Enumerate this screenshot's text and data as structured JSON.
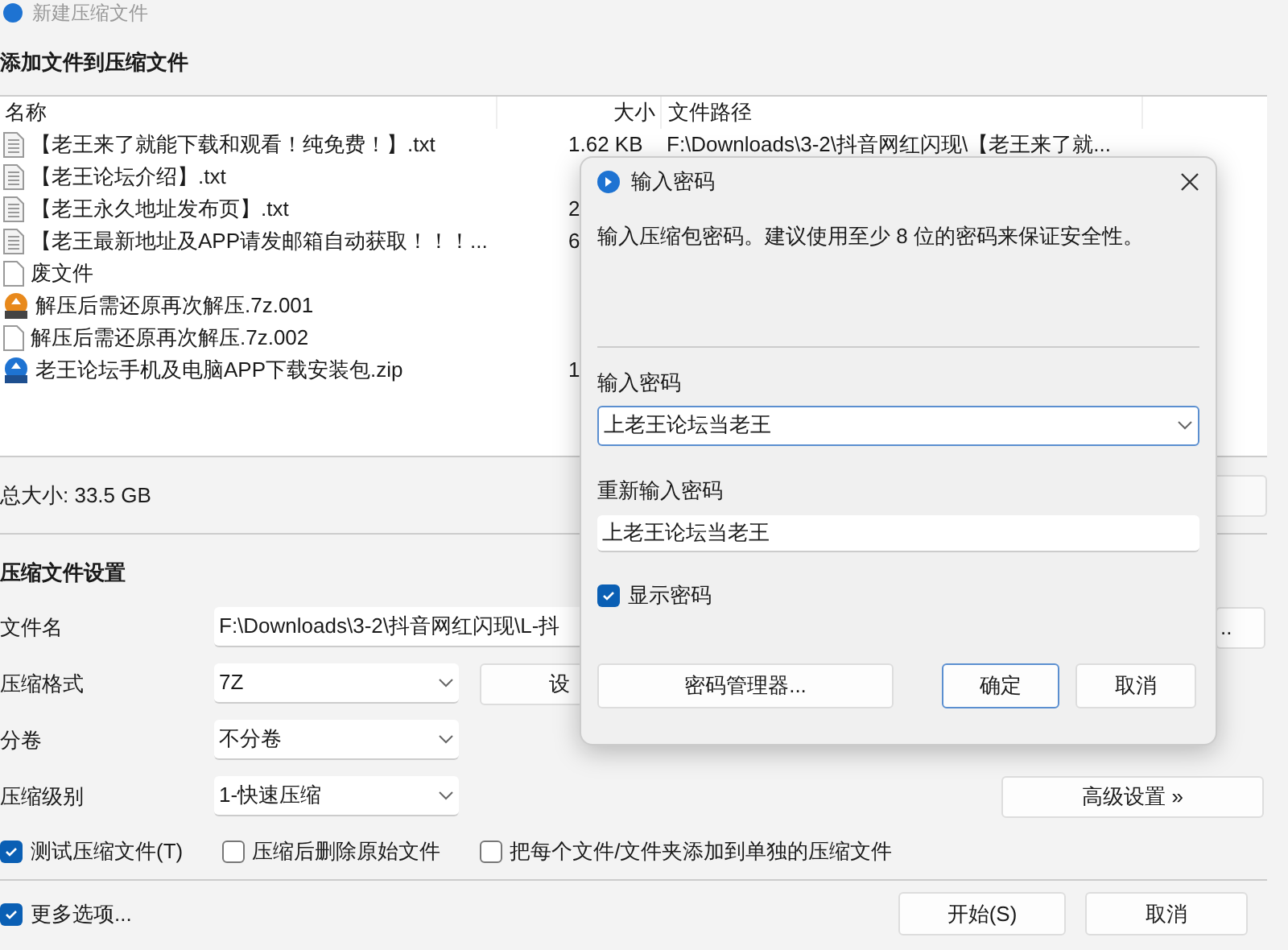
{
  "window": {
    "title": "新建压缩文件"
  },
  "heading": "添加文件到压缩文件",
  "file_list": {
    "columns": [
      "名称",
      "大小",
      "文件路径"
    ],
    "rows": [
      {
        "kind": "text",
        "name": "【老王来了就能下载和观看！纯免费！】.txt",
        "size": "1.62 KB",
        "path": "F:\\Downloads\\3-2\\抖音网红闪现\\【老王来了就..."
      },
      {
        "kind": "text",
        "name": "【老王论坛介绍】.txt"
      },
      {
        "kind": "text",
        "name": "【老王永久地址发布页】.txt",
        "size": "2"
      },
      {
        "kind": "text",
        "name": "【老王最新地址及APP请发邮箱自动获取！！！...",
        "size": "6"
      },
      {
        "kind": "blank",
        "name": "废文件"
      },
      {
        "kind": "archive-7z",
        "name": "解压后需还原再次解压.7z.001"
      },
      {
        "kind": "blank",
        "name": "解压后需还原再次解压.7z.002"
      },
      {
        "kind": "archive-zip",
        "name": "老王论坛手机及电脑APP下载安装包.zip",
        "size": "1"
      }
    ]
  },
  "total_size": "总大小: 33.5 GB",
  "settings": {
    "title": "压缩文件设置",
    "file_name": {
      "label": "文件名",
      "value": "F:\\Downloads\\3-2\\抖音网红闪现\\L-抖",
      "browse": ".."
    },
    "format": {
      "label": "压缩格式",
      "value": "7Z",
      "button": "设"
    },
    "volume": {
      "label": "分卷",
      "value": "不分卷"
    },
    "level": {
      "label": "压缩级别",
      "value": "1-快速压缩",
      "button": "高级设置 »"
    },
    "options": [
      {
        "label": "测试压缩文件(T)",
        "checked": true
      },
      {
        "label": "压缩后删除原始文件",
        "checked": false
      },
      {
        "label": "把每个文件/文件夹添加到单独的压缩文件",
        "checked": false
      }
    ]
  },
  "more_options": {
    "label": "更多选项...",
    "checked": true
  },
  "buttons": [
    "开始(S)",
    "取消"
  ],
  "dialog": {
    "title": "输入密码",
    "description": "输入压缩包密码。建议使用至少 8 位的密码来保证安全性。",
    "password_label": "输入密码",
    "password": "上老王论坛当老王",
    "confirm_label": "重新输入密码",
    "confirm": "上老王论坛当老王",
    "show_password": {
      "label": "显示密码",
      "checked": true
    },
    "buttons": [
      "密码管理器...",
      "确定",
      "取消"
    ]
  }
}
